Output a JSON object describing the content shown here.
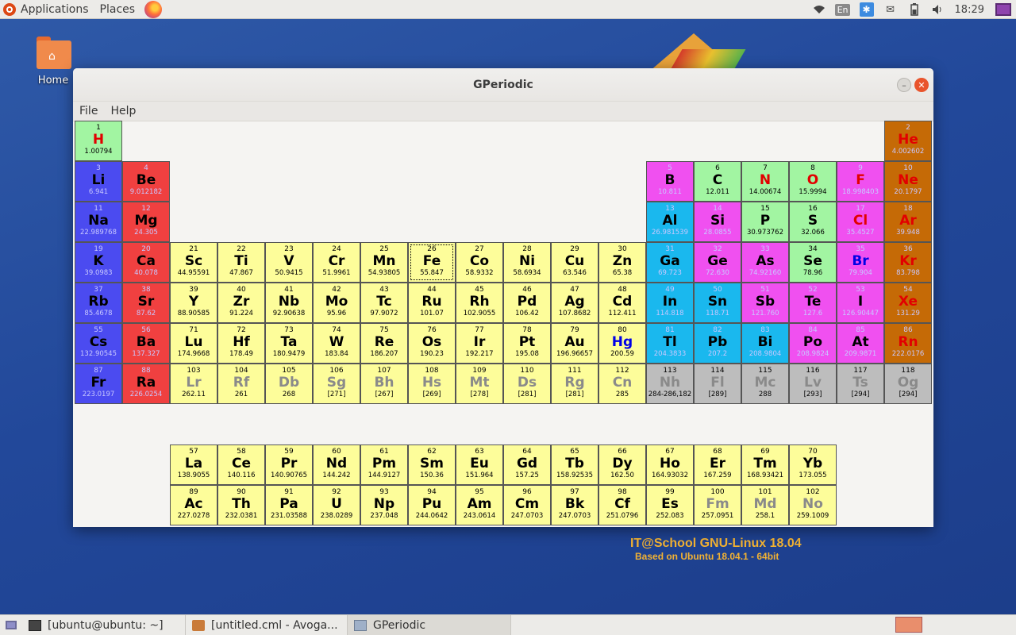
{
  "top_panel": {
    "applications": "Applications",
    "places": "Places",
    "lang": "En",
    "clock": "18:29"
  },
  "desktop": {
    "home_label": "Home",
    "brand_line1": "IT@School GNU-Linux 18.04",
    "brand_line2": "Based on Ubuntu 18.04.1 - 64bit"
  },
  "window": {
    "title": "GPeriodic",
    "menu": [
      "File",
      "Help"
    ]
  },
  "elements": [
    {
      "n": "1",
      "s": "H",
      "w": "1.00794",
      "r": 1,
      "c": 1,
      "cat": "nonmetal",
      "st": "gas"
    },
    {
      "n": "2",
      "s": "He",
      "w": "4.002602",
      "r": 1,
      "c": 18,
      "cat": "noble",
      "st": "gas"
    },
    {
      "n": "3",
      "s": "Li",
      "w": "6.941",
      "r": 2,
      "c": 1,
      "cat": "alkali",
      "st": "solid"
    },
    {
      "n": "4",
      "s": "Be",
      "w": "9.012182",
      "r": 2,
      "c": 2,
      "cat": "alkaline",
      "st": "solid"
    },
    {
      "n": "5",
      "s": "B",
      "w": "10.811",
      "r": 2,
      "c": 13,
      "cat": "metalloid",
      "st": "solid"
    },
    {
      "n": "6",
      "s": "C",
      "w": "12.011",
      "r": 2,
      "c": 14,
      "cat": "nonmetal",
      "st": "solid"
    },
    {
      "n": "7",
      "s": "N",
      "w": "14.00674",
      "r": 2,
      "c": 15,
      "cat": "nonmetal",
      "st": "gas"
    },
    {
      "n": "8",
      "s": "O",
      "w": "15.9994",
      "r": 2,
      "c": 16,
      "cat": "nonmetal",
      "st": "gas"
    },
    {
      "n": "9",
      "s": "F",
      "w": "18.998403",
      "r": 2,
      "c": 17,
      "cat": "halogen",
      "st": "gas"
    },
    {
      "n": "10",
      "s": "Ne",
      "w": "20.1797",
      "r": 2,
      "c": 18,
      "cat": "noble",
      "st": "gas"
    },
    {
      "n": "11",
      "s": "Na",
      "w": "22.989768",
      "r": 3,
      "c": 1,
      "cat": "alkali",
      "st": "solid"
    },
    {
      "n": "12",
      "s": "Mg",
      "w": "24.305",
      "r": 3,
      "c": 2,
      "cat": "alkaline",
      "st": "solid"
    },
    {
      "n": "13",
      "s": "Al",
      "w": "26.981539",
      "r": 3,
      "c": 13,
      "cat": "post",
      "st": "solid"
    },
    {
      "n": "14",
      "s": "Si",
      "w": "28.0855",
      "r": 3,
      "c": 14,
      "cat": "metalloid",
      "st": "solid"
    },
    {
      "n": "15",
      "s": "P",
      "w": "30.973762",
      "r": 3,
      "c": 15,
      "cat": "nonmetal",
      "st": "solid"
    },
    {
      "n": "16",
      "s": "S",
      "w": "32.066",
      "r": 3,
      "c": 16,
      "cat": "nonmetal",
      "st": "solid"
    },
    {
      "n": "17",
      "s": "Cl",
      "w": "35.4527",
      "r": 3,
      "c": 17,
      "cat": "halogen",
      "st": "gas"
    },
    {
      "n": "18",
      "s": "Ar",
      "w": "39.948",
      "r": 3,
      "c": 18,
      "cat": "noble",
      "st": "gas"
    },
    {
      "n": "19",
      "s": "K",
      "w": "39.0983",
      "r": 4,
      "c": 1,
      "cat": "alkali",
      "st": "solid"
    },
    {
      "n": "20",
      "s": "Ca",
      "w": "40.078",
      "r": 4,
      "c": 2,
      "cat": "alkaline",
      "st": "solid"
    },
    {
      "n": "21",
      "s": "Sc",
      "w": "44.95591",
      "r": 4,
      "c": 3,
      "cat": "tm",
      "st": "solid"
    },
    {
      "n": "22",
      "s": "Ti",
      "w": "47.867",
      "r": 4,
      "c": 4,
      "cat": "tm",
      "st": "solid"
    },
    {
      "n": "23",
      "s": "V",
      "w": "50.9415",
      "r": 4,
      "c": 5,
      "cat": "tm",
      "st": "solid"
    },
    {
      "n": "24",
      "s": "Cr",
      "w": "51.9961",
      "r": 4,
      "c": 6,
      "cat": "tm",
      "st": "solid"
    },
    {
      "n": "25",
      "s": "Mn",
      "w": "54.93805",
      "r": 4,
      "c": 7,
      "cat": "tm",
      "st": "solid"
    },
    {
      "n": "26",
      "s": "Fe",
      "w": "55.847",
      "r": 4,
      "c": 8,
      "cat": "tm",
      "st": "solid",
      "sel": true
    },
    {
      "n": "27",
      "s": "Co",
      "w": "58.9332",
      "r": 4,
      "c": 9,
      "cat": "tm",
      "st": "solid"
    },
    {
      "n": "28",
      "s": "Ni",
      "w": "58.6934",
      "r": 4,
      "c": 10,
      "cat": "tm",
      "st": "solid"
    },
    {
      "n": "29",
      "s": "Cu",
      "w": "63.546",
      "r": 4,
      "c": 11,
      "cat": "tm",
      "st": "solid"
    },
    {
      "n": "30",
      "s": "Zn",
      "w": "65.38",
      "r": 4,
      "c": 12,
      "cat": "tm",
      "st": "solid"
    },
    {
      "n": "31",
      "s": "Ga",
      "w": "69.723",
      "r": 4,
      "c": 13,
      "cat": "post",
      "st": "solid"
    },
    {
      "n": "32",
      "s": "Ge",
      "w": "72.630",
      "r": 4,
      "c": 14,
      "cat": "metalloid",
      "st": "solid"
    },
    {
      "n": "33",
      "s": "As",
      "w": "74.92160",
      "r": 4,
      "c": 15,
      "cat": "metalloid",
      "st": "solid"
    },
    {
      "n": "34",
      "s": "Se",
      "w": "78.96",
      "r": 4,
      "c": 16,
      "cat": "nonmetal",
      "st": "solid"
    },
    {
      "n": "35",
      "s": "Br",
      "w": "79.904",
      "r": 4,
      "c": 17,
      "cat": "halogen",
      "st": "liquid"
    },
    {
      "n": "36",
      "s": "Kr",
      "w": "83.798",
      "r": 4,
      "c": 18,
      "cat": "noble",
      "st": "gas"
    },
    {
      "n": "37",
      "s": "Rb",
      "w": "85.4678",
      "r": 5,
      "c": 1,
      "cat": "alkali",
      "st": "solid"
    },
    {
      "n": "38",
      "s": "Sr",
      "w": "87.62",
      "r": 5,
      "c": 2,
      "cat": "alkaline",
      "st": "solid"
    },
    {
      "n": "39",
      "s": "Y",
      "w": "88.90585",
      "r": 5,
      "c": 3,
      "cat": "tm",
      "st": "solid"
    },
    {
      "n": "40",
      "s": "Zr",
      "w": "91.224",
      "r": 5,
      "c": 4,
      "cat": "tm",
      "st": "solid"
    },
    {
      "n": "41",
      "s": "Nb",
      "w": "92.90638",
      "r": 5,
      "c": 5,
      "cat": "tm",
      "st": "solid"
    },
    {
      "n": "42",
      "s": "Mo",
      "w": "95.96",
      "r": 5,
      "c": 6,
      "cat": "tm",
      "st": "solid"
    },
    {
      "n": "43",
      "s": "Tc",
      "w": "97.9072",
      "r": 5,
      "c": 7,
      "cat": "tm",
      "st": "solid"
    },
    {
      "n": "44",
      "s": "Ru",
      "w": "101.07",
      "r": 5,
      "c": 8,
      "cat": "tm",
      "st": "solid"
    },
    {
      "n": "45",
      "s": "Rh",
      "w": "102.9055",
      "r": 5,
      "c": 9,
      "cat": "tm",
      "st": "solid"
    },
    {
      "n": "46",
      "s": "Pd",
      "w": "106.42",
      "r": 5,
      "c": 10,
      "cat": "tm",
      "st": "solid"
    },
    {
      "n": "47",
      "s": "Ag",
      "w": "107.8682",
      "r": 5,
      "c": 11,
      "cat": "tm",
      "st": "solid"
    },
    {
      "n": "48",
      "s": "Cd",
      "w": "112.411",
      "r": 5,
      "c": 12,
      "cat": "tm",
      "st": "solid"
    },
    {
      "n": "49",
      "s": "In",
      "w": "114.818",
      "r": 5,
      "c": 13,
      "cat": "post",
      "st": "solid"
    },
    {
      "n": "50",
      "s": "Sn",
      "w": "118.71",
      "r": 5,
      "c": 14,
      "cat": "post",
      "st": "solid"
    },
    {
      "n": "51",
      "s": "Sb",
      "w": "121.760",
      "r": 5,
      "c": 15,
      "cat": "metalloid",
      "st": "solid"
    },
    {
      "n": "52",
      "s": "Te",
      "w": "127.6",
      "r": 5,
      "c": 16,
      "cat": "metalloid",
      "st": "solid"
    },
    {
      "n": "53",
      "s": "I",
      "w": "126.90447",
      "r": 5,
      "c": 17,
      "cat": "halogen",
      "st": "solid"
    },
    {
      "n": "54",
      "s": "Xe",
      "w": "131.29",
      "r": 5,
      "c": 18,
      "cat": "noble",
      "st": "gas"
    },
    {
      "n": "55",
      "s": "Cs",
      "w": "132.90545",
      "r": 6,
      "c": 1,
      "cat": "alkali",
      "st": "solid"
    },
    {
      "n": "56",
      "s": "Ba",
      "w": "137.327",
      "r": 6,
      "c": 2,
      "cat": "alkaline",
      "st": "solid"
    },
    {
      "n": "71",
      "s": "Lu",
      "w": "174.9668",
      "r": 6,
      "c": 3,
      "cat": "tm",
      "st": "solid"
    },
    {
      "n": "72",
      "s": "Hf",
      "w": "178.49",
      "r": 6,
      "c": 4,
      "cat": "tm",
      "st": "solid"
    },
    {
      "n": "73",
      "s": "Ta",
      "w": "180.9479",
      "r": 6,
      "c": 5,
      "cat": "tm",
      "st": "solid"
    },
    {
      "n": "74",
      "s": "W",
      "w": "183.84",
      "r": 6,
      "c": 6,
      "cat": "tm",
      "st": "solid"
    },
    {
      "n": "75",
      "s": "Re",
      "w": "186.207",
      "r": 6,
      "c": 7,
      "cat": "tm",
      "st": "solid"
    },
    {
      "n": "76",
      "s": "Os",
      "w": "190.23",
      "r": 6,
      "c": 8,
      "cat": "tm",
      "st": "solid"
    },
    {
      "n": "77",
      "s": "Ir",
      "w": "192.217",
      "r": 6,
      "c": 9,
      "cat": "tm",
      "st": "solid"
    },
    {
      "n": "78",
      "s": "Pt",
      "w": "195.08",
      "r": 6,
      "c": 10,
      "cat": "tm",
      "st": "solid"
    },
    {
      "n": "79",
      "s": "Au",
      "w": "196.96657",
      "r": 6,
      "c": 11,
      "cat": "tm",
      "st": "solid"
    },
    {
      "n": "80",
      "s": "Hg",
      "w": "200.59",
      "r": 6,
      "c": 12,
      "cat": "tm",
      "st": "liquid"
    },
    {
      "n": "81",
      "s": "Tl",
      "w": "204.3833",
      "r": 6,
      "c": 13,
      "cat": "post",
      "st": "solid"
    },
    {
      "n": "82",
      "s": "Pb",
      "w": "207.2",
      "r": 6,
      "c": 14,
      "cat": "post",
      "st": "solid"
    },
    {
      "n": "83",
      "s": "Bi",
      "w": "208.9804",
      "r": 6,
      "c": 15,
      "cat": "post",
      "st": "solid"
    },
    {
      "n": "84",
      "s": "Po",
      "w": "208.9824",
      "r": 6,
      "c": 16,
      "cat": "metalloid",
      "st": "solid"
    },
    {
      "n": "85",
      "s": "At",
      "w": "209.9871",
      "r": 6,
      "c": 17,
      "cat": "halogen",
      "st": "solid"
    },
    {
      "n": "86",
      "s": "Rn",
      "w": "222.0176",
      "r": 6,
      "c": 18,
      "cat": "noble",
      "st": "gas"
    },
    {
      "n": "87",
      "s": "Fr",
      "w": "223.0197",
      "r": 7,
      "c": 1,
      "cat": "alkali",
      "st": "solid"
    },
    {
      "n": "88",
      "s": "Ra",
      "w": "226.0254",
      "r": 7,
      "c": 2,
      "cat": "alkaline",
      "st": "solid"
    },
    {
      "n": "103",
      "s": "Lr",
      "w": "262.11",
      "r": 7,
      "c": 3,
      "cat": "tm",
      "st": "synth"
    },
    {
      "n": "104",
      "s": "Rf",
      "w": "261",
      "r": 7,
      "c": 4,
      "cat": "tm",
      "st": "synth"
    },
    {
      "n": "105",
      "s": "Db",
      "w": "268",
      "r": 7,
      "c": 5,
      "cat": "tm",
      "st": "synth"
    },
    {
      "n": "106",
      "s": "Sg",
      "w": "[271]",
      "r": 7,
      "c": 6,
      "cat": "tm",
      "st": "synth"
    },
    {
      "n": "107",
      "s": "Bh",
      "w": "[267]",
      "r": 7,
      "c": 7,
      "cat": "tm",
      "st": "synth"
    },
    {
      "n": "108",
      "s": "Hs",
      "w": "[269]",
      "r": 7,
      "c": 8,
      "cat": "tm",
      "st": "synth"
    },
    {
      "n": "109",
      "s": "Mt",
      "w": "[278]",
      "r": 7,
      "c": 9,
      "cat": "tm",
      "st": "synth"
    },
    {
      "n": "110",
      "s": "Ds",
      "w": "[281]",
      "r": 7,
      "c": 10,
      "cat": "tm",
      "st": "synth"
    },
    {
      "n": "111",
      "s": "Rg",
      "w": "[281]",
      "r": 7,
      "c": 11,
      "cat": "tm",
      "st": "synth"
    },
    {
      "n": "112",
      "s": "Cn",
      "w": "285",
      "r": 7,
      "c": 12,
      "cat": "tm",
      "st": "synth"
    },
    {
      "n": "113",
      "s": "Nh",
      "w": "284-286,182",
      "r": 7,
      "c": 13,
      "cat": "unknown",
      "st": "synth"
    },
    {
      "n": "114",
      "s": "Fl",
      "w": "[289]",
      "r": 7,
      "c": 14,
      "cat": "unknown",
      "st": "synth"
    },
    {
      "n": "115",
      "s": "Mc",
      "w": "288",
      "r": 7,
      "c": 15,
      "cat": "unknown",
      "st": "synth"
    },
    {
      "n": "116",
      "s": "Lv",
      "w": "[293]",
      "r": 7,
      "c": 16,
      "cat": "unknown",
      "st": "synth"
    },
    {
      "n": "117",
      "s": "Ts",
      "w": "[294]",
      "r": 7,
      "c": 17,
      "cat": "unknown",
      "st": "synth"
    },
    {
      "n": "118",
      "s": "Og",
      "w": "[294]",
      "r": 7,
      "c": 18,
      "cat": "unknown",
      "st": "synth"
    },
    {
      "n": "57",
      "s": "La",
      "w": "138.9055",
      "r": 9,
      "c": 3,
      "cat": "lanth",
      "st": "solid"
    },
    {
      "n": "58",
      "s": "Ce",
      "w": "140.116",
      "r": 9,
      "c": 4,
      "cat": "lanth",
      "st": "solid"
    },
    {
      "n": "59",
      "s": "Pr",
      "w": "140.90765",
      "r": 9,
      "c": 5,
      "cat": "lanth",
      "st": "solid"
    },
    {
      "n": "60",
      "s": "Nd",
      "w": "144.242",
      "r": 9,
      "c": 6,
      "cat": "lanth",
      "st": "solid"
    },
    {
      "n": "61",
      "s": "Pm",
      "w": "144.9127",
      "r": 9,
      "c": 7,
      "cat": "lanth",
      "st": "solid"
    },
    {
      "n": "62",
      "s": "Sm",
      "w": "150.36",
      "r": 9,
      "c": 8,
      "cat": "lanth",
      "st": "solid"
    },
    {
      "n": "63",
      "s": "Eu",
      "w": "151.964",
      "r": 9,
      "c": 9,
      "cat": "lanth",
      "st": "solid"
    },
    {
      "n": "64",
      "s": "Gd",
      "w": "157.25",
      "r": 9,
      "c": 10,
      "cat": "lanth",
      "st": "solid"
    },
    {
      "n": "65",
      "s": "Tb",
      "w": "158.92535",
      "r": 9,
      "c": 11,
      "cat": "lanth",
      "st": "solid"
    },
    {
      "n": "66",
      "s": "Dy",
      "w": "162.50",
      "r": 9,
      "c": 12,
      "cat": "lanth",
      "st": "solid"
    },
    {
      "n": "67",
      "s": "Ho",
      "w": "164.93032",
      "r": 9,
      "c": 13,
      "cat": "lanth",
      "st": "solid"
    },
    {
      "n": "68",
      "s": "Er",
      "w": "167.259",
      "r": 9,
      "c": 14,
      "cat": "lanth",
      "st": "solid"
    },
    {
      "n": "69",
      "s": "Tm",
      "w": "168.93421",
      "r": 9,
      "c": 15,
      "cat": "lanth",
      "st": "solid"
    },
    {
      "n": "70",
      "s": "Yb",
      "w": "173.055",
      "r": 9,
      "c": 16,
      "cat": "lanth",
      "st": "solid"
    },
    {
      "n": "89",
      "s": "Ac",
      "w": "227.0278",
      "r": 10,
      "c": 3,
      "cat": "act",
      "st": "solid"
    },
    {
      "n": "90",
      "s": "Th",
      "w": "232.0381",
      "r": 10,
      "c": 4,
      "cat": "act",
      "st": "solid"
    },
    {
      "n": "91",
      "s": "Pa",
      "w": "231.03588",
      "r": 10,
      "c": 5,
      "cat": "act",
      "st": "solid"
    },
    {
      "n": "92",
      "s": "U",
      "w": "238.0289",
      "r": 10,
      "c": 6,
      "cat": "act",
      "st": "solid"
    },
    {
      "n": "93",
      "s": "Np",
      "w": "237.048",
      "r": 10,
      "c": 7,
      "cat": "act",
      "st": "solid"
    },
    {
      "n": "94",
      "s": "Pu",
      "w": "244.0642",
      "r": 10,
      "c": 8,
      "cat": "act",
      "st": "solid"
    },
    {
      "n": "95",
      "s": "Am",
      "w": "243.0614",
      "r": 10,
      "c": 9,
      "cat": "act",
      "st": "solid"
    },
    {
      "n": "96",
      "s": "Cm",
      "w": "247.0703",
      "r": 10,
      "c": 10,
      "cat": "act",
      "st": "solid"
    },
    {
      "n": "97",
      "s": "Bk",
      "w": "247.0703",
      "r": 10,
      "c": 11,
      "cat": "act",
      "st": "solid"
    },
    {
      "n": "98",
      "s": "Cf",
      "w": "251.0796",
      "r": 10,
      "c": 12,
      "cat": "act",
      "st": "solid"
    },
    {
      "n": "99",
      "s": "Es",
      "w": "252.083",
      "r": 10,
      "c": 13,
      "cat": "act",
      "st": "solid"
    },
    {
      "n": "100",
      "s": "Fm",
      "w": "257.0951",
      "r": 10,
      "c": 14,
      "cat": "act",
      "st": "synth"
    },
    {
      "n": "101",
      "s": "Md",
      "w": "258.1",
      "r": 10,
      "c": 15,
      "cat": "act",
      "st": "synth"
    },
    {
      "n": "102",
      "s": "No",
      "w": "259.1009",
      "r": 10,
      "c": 16,
      "cat": "act",
      "st": "synth"
    }
  ],
  "taskbar": {
    "tasks": [
      "[ubuntu@ubuntu: ~]",
      "[untitled.cml - Avoga...",
      "GPeriodic"
    ]
  }
}
